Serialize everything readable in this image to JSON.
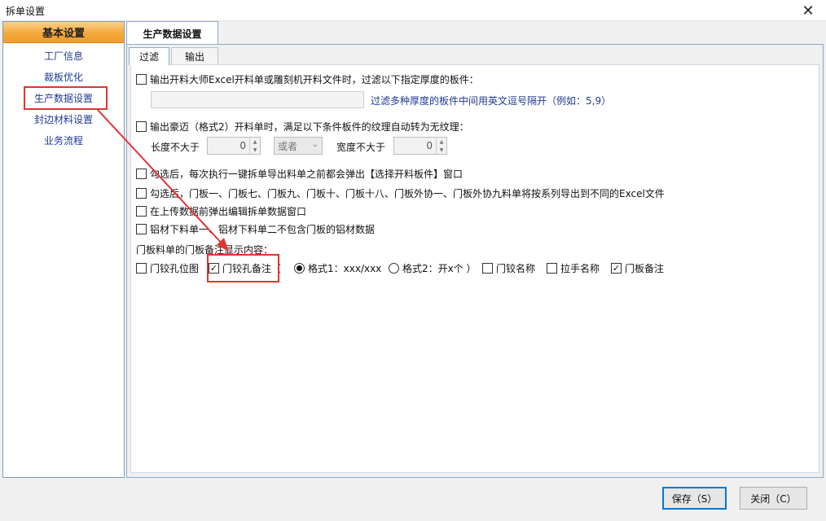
{
  "window": {
    "title": "拆单设置",
    "close_icon": "close-icon"
  },
  "sidebar": {
    "header": "基本设置",
    "items": [
      {
        "label": "工厂信息"
      },
      {
        "label": "裁板优化"
      },
      {
        "label": "生产数据设置",
        "highlighted": true
      },
      {
        "label": "封边材料设置"
      },
      {
        "label": "业务流程"
      }
    ]
  },
  "outer_tab": {
    "label": "生产数据设置"
  },
  "inner_tabs": [
    {
      "label": "过滤",
      "active": true
    },
    {
      "label": "输出",
      "active": false
    }
  ],
  "filter": {
    "opt1": {
      "label": "输出开料大师Excel开料单或雕刻机开料文件时，过滤以下指定厚度的板件：",
      "checked": false
    },
    "thickness_input": {
      "value": ""
    },
    "thickness_hint": "过滤多种厚度的板件中间用英文逗号隔开（例如：5,9）",
    "opt2": {
      "label": "输出豪迈（格式2）开料单时，满足以下条件板件的纹理自动转为无纹理：",
      "checked": false
    },
    "length_label": "长度不大于",
    "length_value": "0",
    "logic_value": "或者",
    "width_label": "宽度不大于",
    "width_value": "0",
    "opt3": {
      "label": "勾选后，每次执行一键拆单导出料单之前都会弹出【选择开料板件】窗口",
      "checked": false
    },
    "opt4": {
      "label": "勾选后，门板一、门板七、门板九、门板十、门板十八、门板外协一、门板外协九料单将按系列导出到不同的Excel文件",
      "checked": false
    },
    "opt5": {
      "label": "在上传数据前弹出编辑拆单数据窗口",
      "checked": false
    },
    "opt6": {
      "label": "铝材下料单一、铝材下料单二不包含门板的铝材数据",
      "checked": false
    },
    "door_note_title": "门板料单的门板备注显示内容：",
    "door_note": {
      "hinge_hole_pos": {
        "label": "门铰孔位图",
        "checked": false
      },
      "hinge_hole_note": {
        "label": "门铰孔备注",
        "checked": true,
        "paren_open": "（"
      },
      "format1": {
        "label": "格式1：xxx/xxx",
        "selected": true
      },
      "format2": {
        "label": "格式2：开x个 ）",
        "selected": false
      },
      "hinge_name": {
        "label": "门铰名称",
        "checked": false
      },
      "handle_name": {
        "label": "拉手名称",
        "checked": false
      },
      "door_note": {
        "label": "门板备注",
        "checked": true
      }
    }
  },
  "footer": {
    "save_label": "保存（S）",
    "close_label": "关闭（C）"
  },
  "colors": {
    "accent_orange": "#f3a93c",
    "highlight_red": "#e53333",
    "link_blue": "#1f3a93",
    "border_blue": "#8ea9c8"
  }
}
